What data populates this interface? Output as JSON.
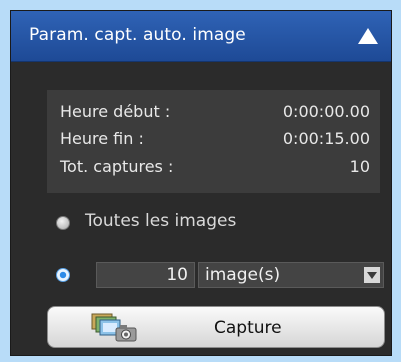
{
  "panel": {
    "title": "Param. capt. auto. image",
    "collapse_icon": "triangle-up-icon"
  },
  "info": {
    "rows": [
      {
        "label": "Heure début :",
        "value": "0:00:00.00"
      },
      {
        "label": "Heure fin :",
        "value": "0:00:15.00"
      },
      {
        "label": "Tot. captures :",
        "value": "10"
      }
    ]
  },
  "options": {
    "all_images_label": "Toutes les images",
    "count_value": "10",
    "unit_selected": "image(s)",
    "selected_option": "count"
  },
  "capture": {
    "label": "Capture",
    "icon": "capture-images-icon"
  },
  "colors": {
    "header": "#2455a4",
    "panel": "#2b2b2b",
    "background": "#b8dcf8"
  }
}
